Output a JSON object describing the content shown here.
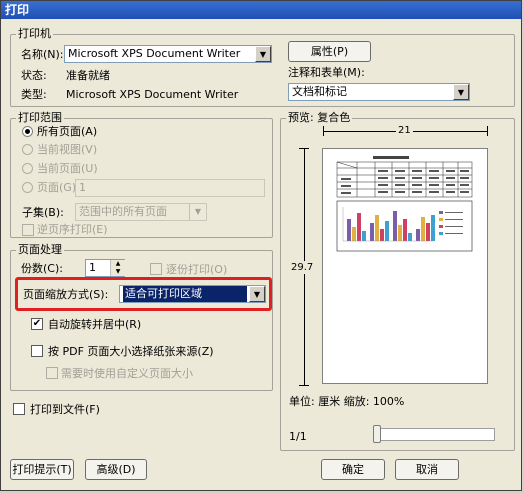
{
  "window": {
    "title": "打印"
  },
  "printer": {
    "group_label": "打印机",
    "name_label": "名称(N):",
    "name_value": "Microsoft XPS Document Writer",
    "properties_button": "属性(P)",
    "status_label": "状态:",
    "status_value": "准备就绪",
    "type_label": "类型:",
    "type_value": "Microsoft XPS Document Writer",
    "comments_label": "注释和表单(M):",
    "comments_value": "文档和标记"
  },
  "range": {
    "group_label": "打印范围",
    "all_pages": "所有页面(A)",
    "current_view": "当前视图(V)",
    "current_page": "当前页面(U)",
    "pages": "页面(G)",
    "pages_value": "1",
    "subset_label": "子集(B):",
    "subset_value": "范围中的所有页面",
    "reverse": "逆页序打印(E)"
  },
  "handling": {
    "group_label": "页面处理",
    "copies_label": "份数(C):",
    "copies_value": "1",
    "collate": "逐份打印(O)",
    "scaling_label": "页面缩放方式(S):",
    "scaling_value": "适合可打印区域",
    "auto_rotate": "自动旋转并居中(R)",
    "pdf_size": "按 PDF 页面大小选择纸张来源(Z)",
    "custom_size": "需要时使用自定义页面大小"
  },
  "preview": {
    "label": "预览: 复合色",
    "width_value": "21",
    "height_value": "29.7",
    "units_zoom": "单位: 厘米 缩放: 100%",
    "page_counter": "1/1"
  },
  "print_to_file": "打印到文件(F)",
  "buttons": {
    "print_tips": "打印提示(T)",
    "advanced": "高级(D)",
    "ok": "确定",
    "cancel": "取消"
  },
  "highlight_color": "#e02020",
  "chart_bar_colors": [
    "#7a5fa8",
    "#e0b040",
    "#d04060",
    "#40a0d0",
    "#60b060",
    "#c080c0"
  ]
}
